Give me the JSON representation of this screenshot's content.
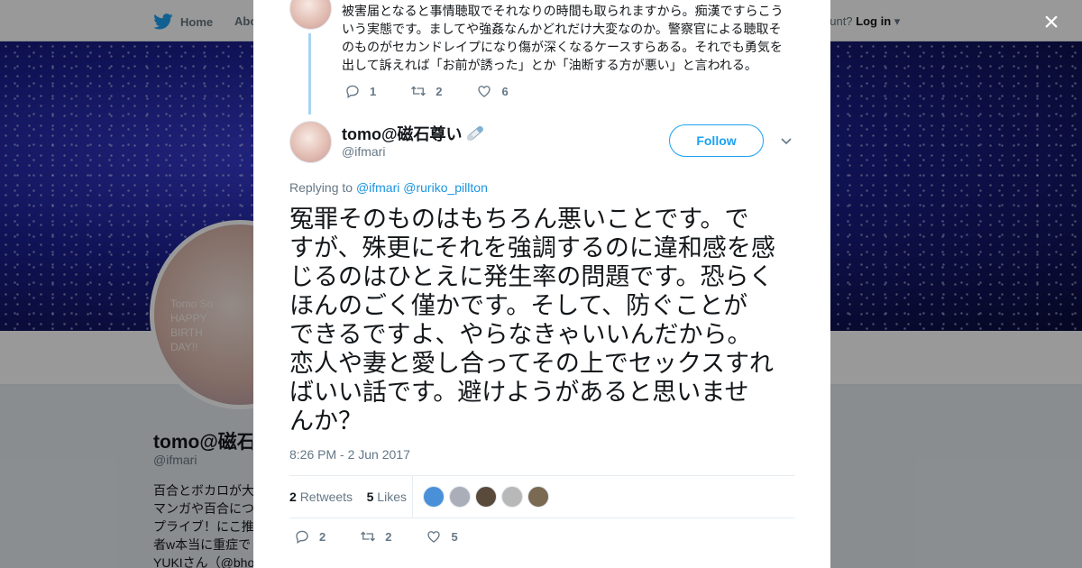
{
  "background_page": {
    "nav": {
      "home_label": "Home",
      "about_label": "Abo",
      "account_prompt": "ccount?",
      "login_label": "Log in"
    },
    "profile": {
      "name": "tomo@磁石",
      "handle": "@ifmari",
      "avatar_text": [
        "Tomo So",
        "HAPPY",
        "BIRTH",
        "DAY!!"
      ],
      "bio_lines": [
        "百合とボカロが大",
        "マンガや百合につ",
        "プライブ！にこ推",
        "者w本当に重症で",
        "YUKIさん（@bho"
      ]
    }
  },
  "modal": {
    "close_label": "×",
    "previous_tweet": {
      "text_lines": [
        "被害届となると事情聴取でそれなりの時間も取られますから。痴漢ですらこう",
        "いう実態です。ましてや強姦なんかどれだけ大変なのか。警察官による聴取そ",
        "のものがセカンドレイプになり傷が深くなるケースすらある。それでも勇気を",
        "出して訴えれば「お前が誘った」とか「油断する方が悪い」と言われる。"
      ],
      "replies": "1",
      "retweets": "2",
      "likes": "6"
    },
    "tweet": {
      "author_name": "tomo@磁石尊い",
      "author_handle": "@ifmari",
      "follow_label": "Follow",
      "replying_prefix": "Replying to",
      "replying_mentions": [
        "@ifmari",
        "@ruriko_pillton"
      ],
      "text_lines": [
        "冤罪そのものはもちろん悪いことです。で",
        "すが、殊更にそれを強調するのに違和感を感",
        "じるのはひとえに発生率の問題です。恐らく",
        "ほんのごく僅かです。そして、防ぐことが",
        "できるですよ、やらなきゃいいんだから。",
        "恋人や妻と愛し合ってその上でセックスすれ",
        "ばいい話です。避けようがあると思いませ",
        "んか？"
      ],
      "timestamp": "8:26 PM - 2 Jun 2017",
      "retweet_count": "2",
      "retweets_label": "Retweets",
      "like_count": "5",
      "likes_label": "Likes",
      "liker_avatar_colors": [
        "#4a90d9",
        "#a9aeb8",
        "#5a4a3c",
        "#b8b8b8",
        "#7a6a52"
      ],
      "replies": "2",
      "retweets": "2",
      "likes": "5"
    }
  },
  "colors": {
    "accent": "#1da1f2",
    "link": "#1b95e0",
    "muted": "#657786",
    "thread_line": "#a6d4f2"
  }
}
